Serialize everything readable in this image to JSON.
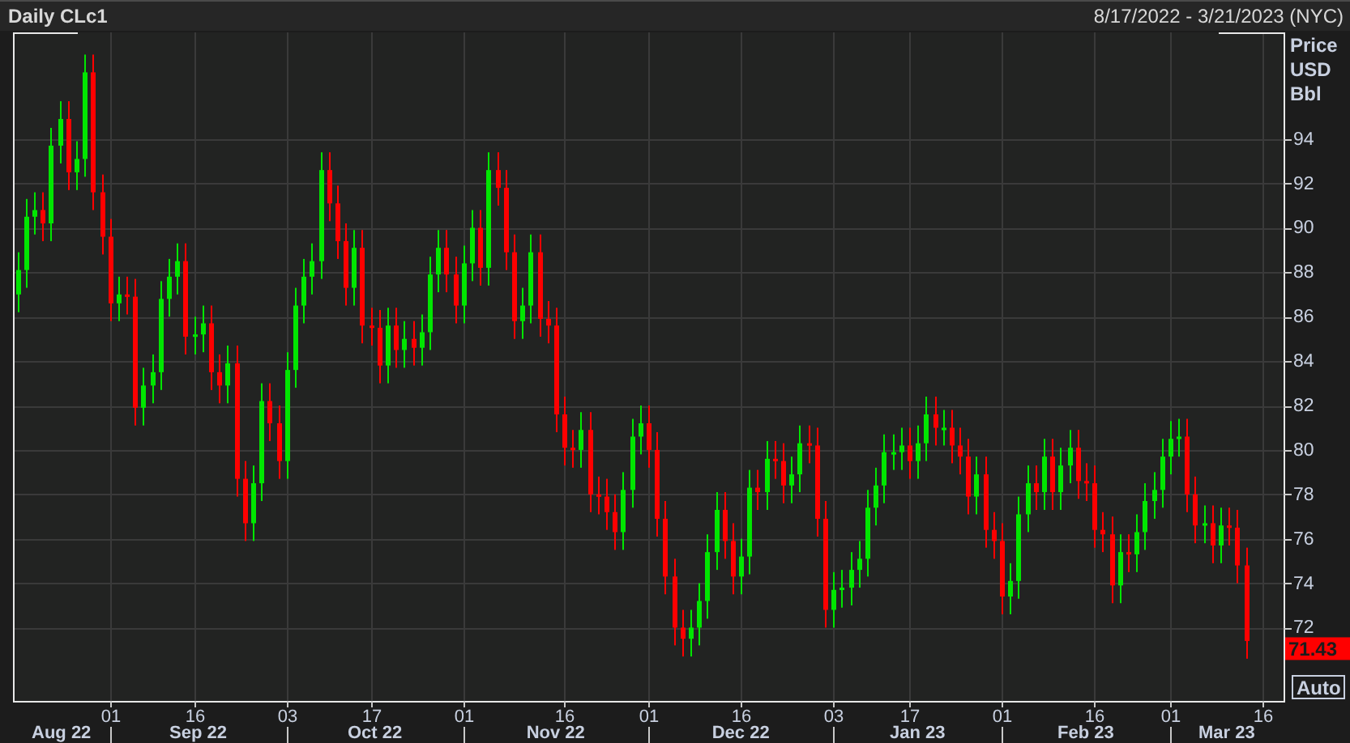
{
  "header": {
    "title": "Daily CLc1",
    "date_range": "8/17/2022 - 3/21/2023 (NYC)"
  },
  "chart": {
    "price_axis_title": [
      "Price",
      "USD",
      "Bbl"
    ],
    "last_price": "71.43",
    "month_labels": [
      "Aug 22",
      "Sep 22",
      "Oct 22",
      "Nov 22",
      "Dec 22",
      "Jan 23",
      "Feb 23",
      "Mar 23"
    ],
    "auto_button": "Auto",
    "chart_data": {
      "type": "candlestick",
      "grid": true,
      "ylim": [
        68.7,
        98.8
      ],
      "categories": [
        null,
        null,
        null,
        null,
        null,
        null,
        null,
        null,
        null,
        null,
        null,
        "01",
        null,
        null,
        null,
        null,
        null,
        null,
        null,
        null,
        null,
        "16",
        null,
        null,
        null,
        null,
        null,
        null,
        null,
        null,
        null,
        null,
        "03",
        null,
        null,
        null,
        null,
        null,
        null,
        null,
        null,
        null,
        "17",
        null,
        null,
        null,
        null,
        null,
        null,
        null,
        null,
        null,
        null,
        "01",
        null,
        null,
        null,
        null,
        null,
        null,
        null,
        null,
        null,
        null,
        null,
        "16",
        null,
        null,
        null,
        null,
        null,
        null,
        null,
        null,
        null,
        "01",
        null,
        null,
        null,
        null,
        null,
        null,
        null,
        null,
        null,
        null,
        "16",
        null,
        null,
        null,
        null,
        null,
        null,
        null,
        null,
        null,
        null,
        "03",
        null,
        null,
        null,
        null,
        null,
        null,
        null,
        null,
        "17",
        null,
        null,
        null,
        null,
        null,
        null,
        null,
        null,
        null,
        null,
        "01",
        null,
        null,
        null,
        null,
        null,
        null,
        null,
        null,
        null,
        null,
        "16",
        null,
        null,
        null,
        null,
        null,
        null,
        null,
        null,
        "01",
        null,
        null,
        null,
        null,
        null,
        null,
        null,
        null,
        null,
        null,
        "16",
        null,
        null
      ],
      "yticks": [
        94,
        92,
        90,
        88,
        86,
        84,
        82,
        80,
        78,
        76,
        74,
        72
      ],
      "ohlc": [
        [
          87.0,
          88.9,
          86.2,
          88.1
        ],
        [
          88.1,
          91.3,
          87.3,
          90.5
        ],
        [
          90.5,
          91.6,
          89.7,
          90.8
        ],
        [
          90.8,
          91.6,
          89.4,
          90.2
        ],
        [
          90.2,
          94.5,
          89.4,
          93.7
        ],
        [
          93.7,
          95.7,
          92.9,
          94.9
        ],
        [
          94.9,
          95.7,
          91.7,
          92.5
        ],
        [
          92.5,
          93.9,
          91.7,
          93.1
        ],
        [
          93.1,
          97.8,
          92.3,
          97.0
        ],
        [
          97.0,
          97.8,
          90.8,
          91.6
        ],
        [
          91.6,
          92.4,
          88.8,
          89.6
        ],
        [
          89.6,
          90.4,
          85.8,
          86.6
        ],
        [
          86.6,
          87.8,
          85.8,
          87.0
        ],
        [
          87.0,
          87.8,
          86.1,
          86.9
        ],
        [
          86.9,
          87.7,
          81.1,
          81.9
        ],
        [
          81.9,
          83.7,
          81.1,
          82.9
        ],
        [
          82.9,
          84.3,
          82.1,
          83.5
        ],
        [
          83.5,
          87.6,
          82.7,
          86.8
        ],
        [
          86.8,
          88.6,
          86.0,
          87.8
        ],
        [
          87.8,
          89.3,
          87.0,
          88.5
        ],
        [
          88.5,
          89.3,
          84.3,
          85.1
        ],
        [
          85.1,
          86.0,
          84.3,
          85.2
        ],
        [
          85.2,
          86.5,
          84.4,
          85.7
        ],
        [
          85.7,
          86.5,
          82.7,
          83.5
        ],
        [
          83.5,
          84.3,
          82.1,
          82.9
        ],
        [
          82.9,
          84.7,
          82.1,
          83.9
        ],
        [
          83.9,
          84.7,
          77.9,
          78.7
        ],
        [
          78.7,
          79.5,
          75.9,
          76.7
        ],
        [
          76.7,
          79.3,
          75.9,
          78.5
        ],
        [
          78.5,
          83.0,
          77.7,
          82.2
        ],
        [
          82.2,
          83.0,
          80.4,
          81.2
        ],
        [
          81.2,
          82.0,
          78.7,
          79.5
        ],
        [
          79.5,
          84.4,
          78.7,
          83.6
        ],
        [
          83.6,
          87.3,
          82.8,
          86.5
        ],
        [
          86.5,
          88.6,
          85.7,
          87.8
        ],
        [
          87.8,
          89.3,
          87.0,
          88.5
        ],
        [
          88.5,
          93.4,
          87.7,
          92.6
        ],
        [
          92.6,
          93.4,
          90.3,
          91.1
        ],
        [
          91.1,
          91.9,
          88.6,
          89.4
        ],
        [
          89.4,
          90.2,
          86.5,
          87.3
        ],
        [
          87.3,
          89.9,
          86.5,
          89.1
        ],
        [
          89.1,
          89.9,
          84.8,
          85.6
        ],
        [
          85.6,
          86.4,
          84.7,
          85.5
        ],
        [
          85.5,
          86.3,
          83.0,
          83.8
        ],
        [
          83.8,
          86.4,
          83.0,
          85.6
        ],
        [
          85.6,
          86.4,
          83.7,
          84.5
        ],
        [
          84.5,
          85.8,
          83.7,
          85.0
        ],
        [
          85.0,
          85.8,
          83.8,
          84.6
        ],
        [
          84.6,
          86.1,
          83.8,
          85.3
        ],
        [
          85.3,
          88.7,
          84.5,
          87.9
        ],
        [
          87.9,
          89.9,
          87.1,
          89.1
        ],
        [
          89.1,
          89.9,
          87.1,
          87.9
        ],
        [
          87.9,
          88.7,
          85.7,
          86.5
        ],
        [
          86.5,
          89.2,
          85.7,
          88.4
        ],
        [
          88.4,
          90.8,
          87.6,
          90.0
        ],
        [
          90.0,
          90.8,
          87.4,
          88.2
        ],
        [
          88.2,
          93.4,
          87.4,
          92.6
        ],
        [
          92.6,
          93.4,
          91.0,
          91.8
        ],
        [
          91.8,
          92.6,
          88.1,
          88.9
        ],
        [
          88.9,
          89.7,
          85.0,
          85.8
        ],
        [
          85.8,
          87.3,
          85.0,
          86.5
        ],
        [
          86.5,
          89.7,
          85.7,
          88.9
        ],
        [
          88.9,
          89.7,
          85.1,
          85.9
        ],
        [
          85.9,
          86.7,
          84.8,
          85.6
        ],
        [
          85.6,
          86.4,
          80.8,
          81.6
        ],
        [
          81.6,
          82.4,
          79.3,
          80.1
        ],
        [
          80.1,
          80.9,
          79.2,
          80.0
        ],
        [
          80.0,
          81.7,
          79.2,
          80.9
        ],
        [
          80.9,
          81.7,
          77.2,
          78.0
        ],
        [
          78.0,
          78.8,
          77.1,
          77.9
        ],
        [
          77.9,
          78.7,
          76.4,
          77.2
        ],
        [
          77.2,
          78.0,
          75.5,
          76.3
        ],
        [
          76.3,
          79.0,
          75.5,
          78.2
        ],
        [
          78.2,
          81.4,
          77.4,
          80.6
        ],
        [
          80.6,
          82.0,
          79.8,
          81.2
        ],
        [
          81.2,
          82.0,
          79.2,
          80.0
        ],
        [
          80.0,
          80.8,
          76.1,
          76.9
        ],
        [
          76.9,
          77.7,
          73.5,
          74.3
        ],
        [
          74.3,
          75.1,
          71.2,
          72.0
        ],
        [
          72.0,
          72.8,
          70.7,
          71.5
        ],
        [
          71.5,
          72.8,
          70.7,
          72.0
        ],
        [
          72.0,
          74.0,
          71.2,
          73.2
        ],
        [
          73.2,
          76.2,
          72.4,
          75.4
        ],
        [
          75.4,
          78.1,
          74.6,
          77.3
        ],
        [
          77.3,
          78.1,
          75.1,
          75.9
        ],
        [
          75.9,
          76.7,
          73.5,
          74.3
        ],
        [
          74.3,
          76.0,
          73.5,
          75.2
        ],
        [
          75.2,
          79.1,
          74.4,
          78.3
        ],
        [
          78.3,
          79.1,
          77.3,
          78.1
        ],
        [
          78.1,
          80.4,
          77.3,
          79.6
        ],
        [
          79.6,
          80.4,
          78.7,
          79.5
        ],
        [
          79.5,
          80.3,
          77.6,
          78.4
        ],
        [
          78.4,
          79.7,
          77.6,
          78.9
        ],
        [
          78.9,
          81.1,
          78.1,
          80.3
        ],
        [
          80.3,
          81.1,
          79.4,
          80.2
        ],
        [
          80.2,
          81.0,
          76.1,
          76.9
        ],
        [
          76.9,
          77.7,
          72.0,
          72.8
        ],
        [
          72.8,
          74.5,
          72.0,
          73.7
        ],
        [
          73.7,
          74.6,
          72.9,
          73.8
        ],
        [
          73.8,
          75.4,
          73.0,
          74.6
        ],
        [
          74.6,
          75.9,
          73.8,
          75.1
        ],
        [
          75.1,
          78.2,
          74.3,
          77.4
        ],
        [
          77.4,
          79.2,
          76.6,
          78.4
        ],
        [
          78.4,
          80.7,
          77.6,
          79.9
        ],
        [
          79.9,
          80.7,
          79.1,
          79.9
        ],
        [
          79.9,
          81.0,
          79.1,
          80.2
        ],
        [
          80.2,
          81.0,
          78.7,
          79.5
        ],
        [
          79.5,
          81.1,
          78.7,
          80.3
        ],
        [
          80.3,
          82.4,
          79.5,
          81.6
        ],
        [
          81.6,
          82.4,
          80.2,
          81.0
        ],
        [
          81.0,
          81.8,
          80.2,
          81.0
        ],
        [
          81.0,
          81.8,
          79.4,
          80.2
        ],
        [
          80.2,
          81.0,
          78.9,
          79.7
        ],
        [
          79.7,
          80.5,
          77.1,
          77.9
        ],
        [
          77.9,
          79.7,
          77.1,
          78.9
        ],
        [
          78.9,
          79.7,
          75.6,
          76.4
        ],
        [
          76.4,
          77.2,
          75.1,
          75.9
        ],
        [
          75.9,
          76.7,
          72.6,
          73.4
        ],
        [
          73.4,
          74.9,
          72.6,
          74.1
        ],
        [
          74.1,
          77.9,
          73.3,
          77.1
        ],
        [
          77.1,
          79.3,
          76.3,
          78.5
        ],
        [
          78.5,
          79.3,
          77.3,
          78.1
        ],
        [
          78.1,
          80.5,
          77.3,
          79.7
        ],
        [
          79.7,
          80.5,
          77.3,
          78.1
        ],
        [
          78.1,
          80.1,
          77.3,
          79.3
        ],
        [
          79.3,
          80.9,
          78.5,
          80.1
        ],
        [
          80.1,
          80.9,
          77.8,
          78.6
        ],
        [
          78.6,
          79.4,
          77.7,
          78.5
        ],
        [
          78.5,
          79.3,
          75.6,
          76.4
        ],
        [
          76.4,
          77.2,
          75.4,
          76.2
        ],
        [
          76.2,
          77.0,
          73.1,
          73.9
        ],
        [
          73.9,
          76.2,
          73.1,
          75.4
        ],
        [
          75.4,
          76.2,
          74.5,
          75.3
        ],
        [
          75.3,
          77.1,
          74.5,
          76.3
        ],
        [
          76.3,
          78.5,
          75.5,
          77.7
        ],
        [
          77.7,
          79.0,
          76.9,
          78.2
        ],
        [
          78.2,
          80.5,
          77.4,
          79.7
        ],
        [
          79.7,
          81.3,
          78.9,
          80.5
        ],
        [
          80.5,
          81.4,
          79.7,
          80.6
        ],
        [
          80.6,
          81.4,
          77.2,
          78.0
        ],
        [
          78.0,
          78.8,
          75.8,
          76.6
        ],
        [
          76.6,
          77.5,
          75.8,
          76.7
        ],
        [
          76.7,
          77.5,
          74.9,
          75.7
        ],
        [
          75.7,
          77.4,
          74.9,
          76.6
        ],
        [
          76.6,
          77.4,
          75.7,
          76.5
        ],
        [
          76.5,
          77.3,
          74.0,
          74.8
        ],
        [
          74.8,
          75.6,
          70.6,
          71.4
        ],
        null,
        null,
        null,
        null
      ]
    }
  }
}
